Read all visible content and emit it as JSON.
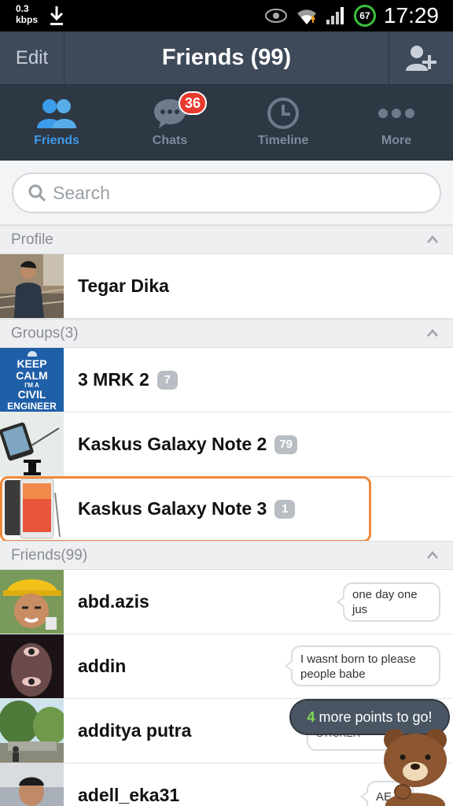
{
  "status_bar": {
    "speed_value": "0.3",
    "speed_unit": "kbps",
    "battery": "67",
    "time": "17:29"
  },
  "header": {
    "edit_label": "Edit",
    "title": "Friends (99)"
  },
  "tabs": [
    {
      "label": "Friends",
      "icon": "friends-icon",
      "active": true
    },
    {
      "label": "Chats",
      "icon": "chat-bubble-icon",
      "badge": "36"
    },
    {
      "label": "Timeline",
      "icon": "clock-icon"
    },
    {
      "label": "More",
      "icon": "more-dots-icon"
    }
  ],
  "search": {
    "placeholder": "Search"
  },
  "sections": {
    "profile": "Profile",
    "groups": "Groups(3)",
    "friends": "Friends(99)"
  },
  "profile": {
    "name": "Tegar Dika"
  },
  "groups": [
    {
      "name": "3 MRK 2",
      "count": "7"
    },
    {
      "name": "Kaskus Galaxy Note 2",
      "count": "79"
    },
    {
      "name": "Kaskus Galaxy Note 3",
      "count": "1"
    }
  ],
  "group_avatar_text": {
    "line1": "KEEP",
    "line2": "CALM",
    "line3": "I'M A",
    "line4": "CIVIL",
    "line5": "ENGINEER"
  },
  "friends": [
    {
      "name": "abd.azis",
      "status": "one day one jus"
    },
    {
      "name": "addin",
      "status": "I wasnt born to please people babe"
    },
    {
      "name": "additya putra",
      "status": "STICKER"
    },
    {
      "name": "adell_eka31",
      "status": "AE"
    }
  ],
  "points": {
    "number": "4",
    "text": "more points to go!"
  },
  "colors": {
    "accent": "#3d9be9",
    "header_bg": "#3e4a5a",
    "tab_bg": "#2e3744",
    "badge": "#e83a2e",
    "highlight": "#f0883a"
  }
}
